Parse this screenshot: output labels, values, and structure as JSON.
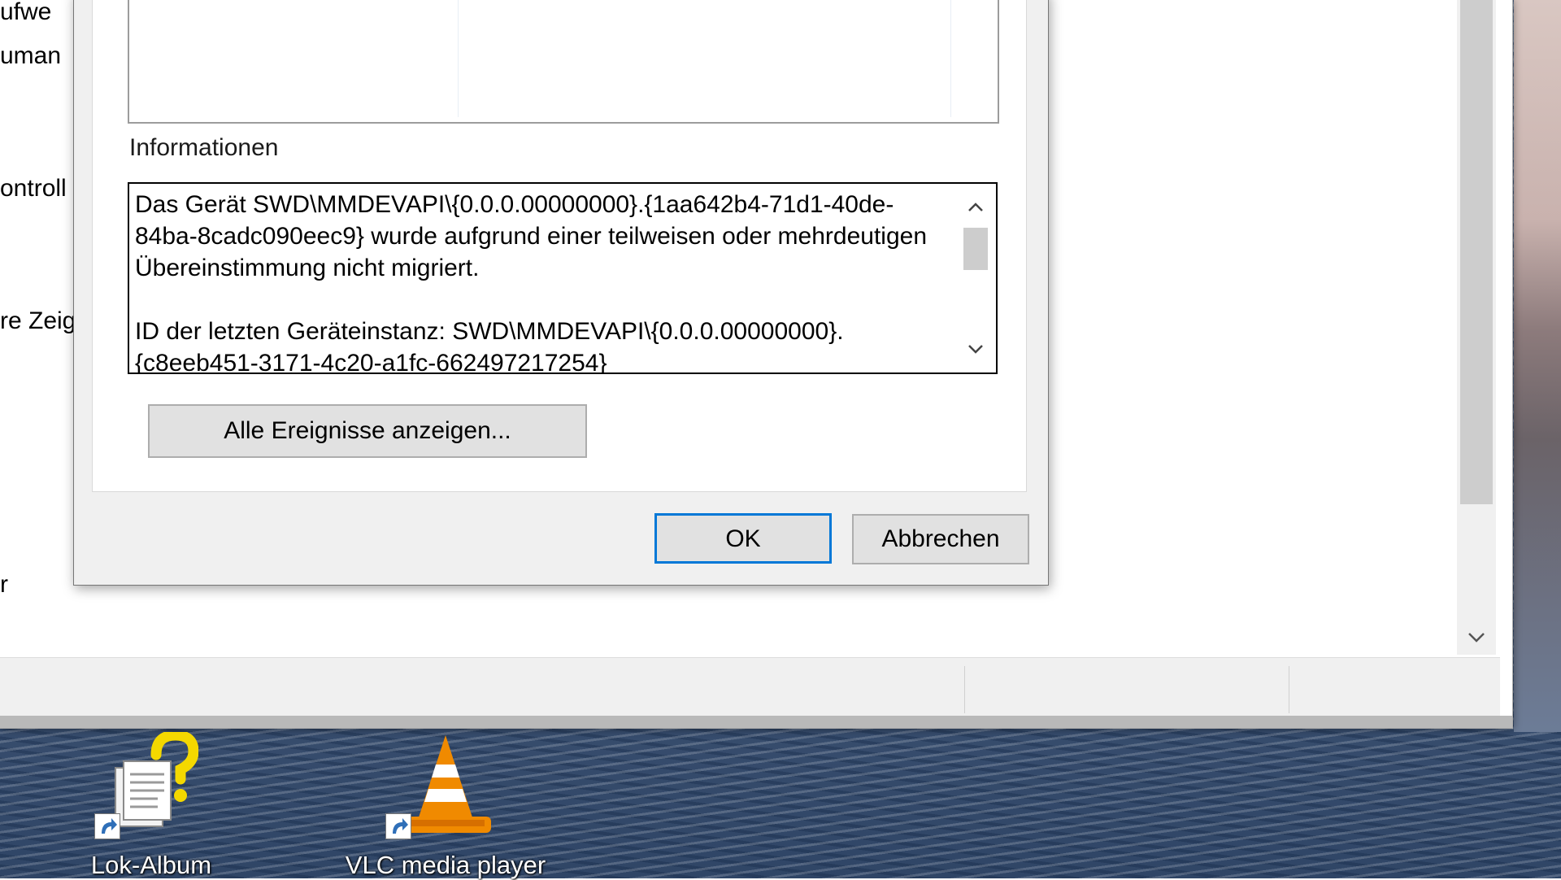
{
  "background_window": {
    "partial_texts": [
      "ufwe",
      "uman",
      "ontroll",
      "re Zeig",
      "r"
    ],
    "scroll_down_icon": "chevron-down-icon"
  },
  "dialog": {
    "info_label": "Informationen",
    "info_text": "Das Gerät SWD\\MMDEVAPI\\{0.0.0.00000000}.{1aa642b4-71d1-40de-84ba-8cadc090eec9} wurde aufgrund einer teilweisen oder mehrdeutigen Übereinstimmung nicht migriert.\n\nID der letzten Geräteinstanz: SWD\\MMDEVAPI\\{0.0.0.00000000}.{c8eeb451-3171-4c20-a1fc-662497217254}",
    "show_all_events_label": "Alle Ereignisse anzeigen...",
    "ok_label": "OK",
    "cancel_label": "Abbrechen"
  },
  "desktop_icons": [
    {
      "label": "Lok-Album",
      "icon": "help-document-icon"
    },
    {
      "label": "VLC media player",
      "icon": "vlc-cone-icon"
    }
  ],
  "colors": {
    "accent": "#0078d7",
    "dialog_bg": "#f0f0f0",
    "button_bg": "#e1e1e1"
  }
}
